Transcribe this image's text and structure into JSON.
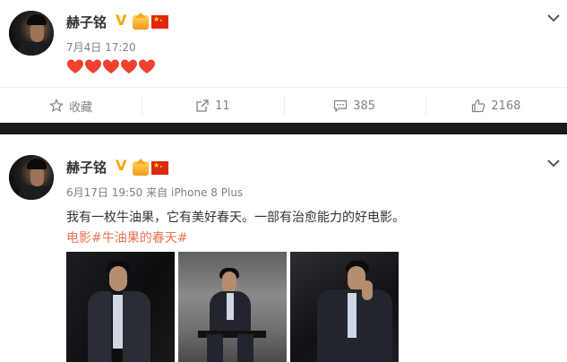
{
  "posts": [
    {
      "author": "赫子铭",
      "verified_badge": "V",
      "timestamp": "7月4日 17:20",
      "content_emoji": [
        "heart",
        "heart",
        "heart",
        "heart",
        "heart"
      ],
      "actions": {
        "favorite_label": "收藏",
        "share_count": "11",
        "comment_count": "385",
        "like_count": "2168"
      }
    },
    {
      "author": "赫子铭",
      "verified_badge": "V",
      "timestamp": "6月17日 19:50",
      "source_prefix": "来自",
      "source_device": "iPhone 8 Plus",
      "text": "我有一枚牛油果，它有美好春天。一部有治愈能力的好电影。",
      "tag_prefix": "电影",
      "hashtag": "#牛油果的春天#",
      "photo_count": 3
    }
  ],
  "colors": {
    "link": "#eb7350",
    "verified": "#f7a600",
    "meta": "#808080",
    "divider": "#1e1914"
  },
  "icons": [
    "chevron-down-icon",
    "verified-icon",
    "vip-crown-icon",
    "china-flag-icon",
    "star-icon",
    "share-icon",
    "comment-icon",
    "like-icon"
  ]
}
